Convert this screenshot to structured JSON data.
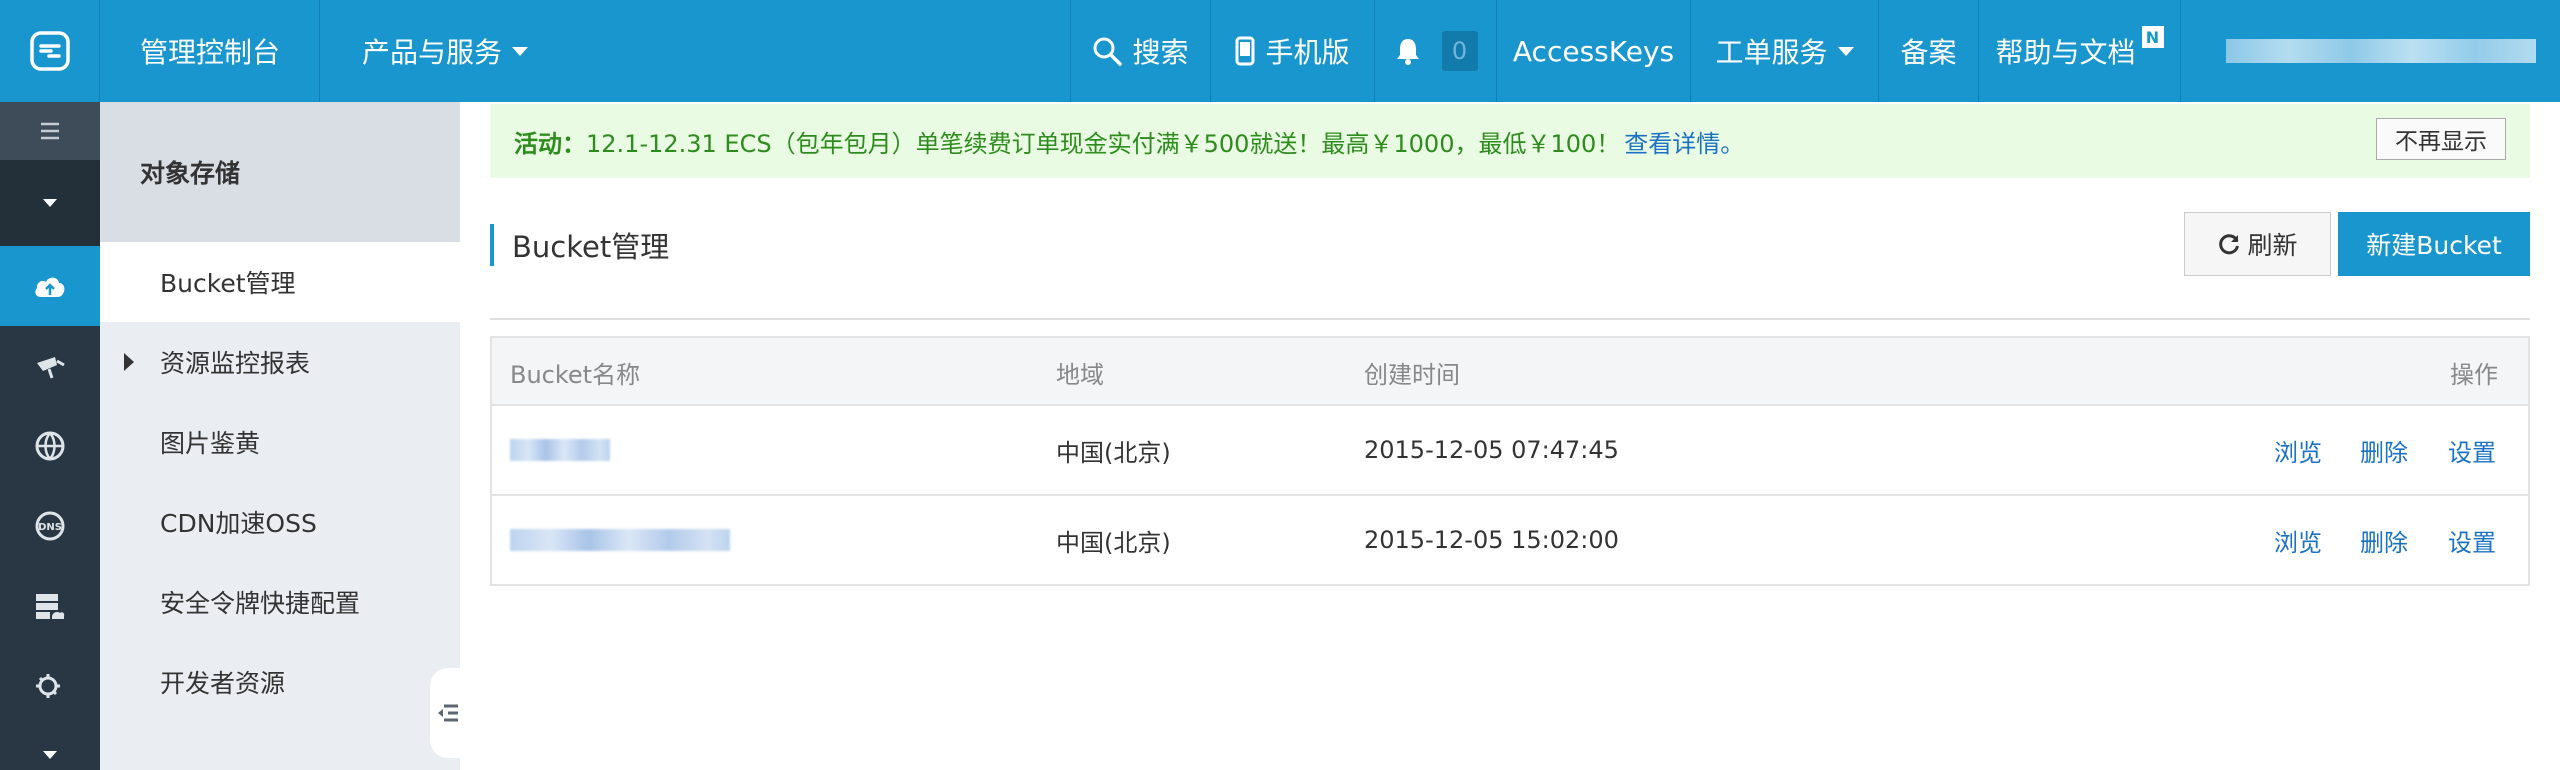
{
  "header": {
    "console_title": "管理控制台",
    "products_label": "产品与服务",
    "search_label": "搜索",
    "mobile_label": "手机版",
    "notification_count": "0",
    "accesskeys_label": "AccessKeys",
    "ticket_label": "工单服务",
    "beian_label": "备案",
    "help_label": "帮助与文档",
    "help_badge": "N"
  },
  "sidebar": {
    "title": "对象存储",
    "items": [
      {
        "label": "Bucket管理",
        "active": true
      },
      {
        "label": "资源监控报表",
        "expandable": true
      },
      {
        "label": "图片鉴黄"
      },
      {
        "label": "CDN加速OSS"
      },
      {
        "label": "安全令牌快捷配置"
      },
      {
        "label": "开发者资源"
      }
    ]
  },
  "banner": {
    "prefix": "活动：",
    "text": "12.1-12.31 ECS（包年包月）单笔续费订单现金实付满￥500就送！最高￥1000，最低￥100！",
    "link": "查看详情。",
    "close_label": "不再显示"
  },
  "main": {
    "title": "Bucket管理",
    "refresh_label": "刷新",
    "new_label": "新建Bucket"
  },
  "table": {
    "columns": [
      "Bucket名称",
      "地域",
      "创建时间",
      "操作"
    ],
    "rows": [
      {
        "region": "中国(北京)",
        "created": "2015-12-05 07:47:45"
      },
      {
        "region": "中国(北京)",
        "created": "2015-12-05 15:02:00"
      }
    ],
    "actions": [
      "浏览",
      "删除",
      "设置"
    ]
  },
  "colors": {
    "brand": "#1a96cf",
    "rail": "#293745",
    "link": "#1a72c4",
    "banner_text": "#2e8c1e"
  }
}
